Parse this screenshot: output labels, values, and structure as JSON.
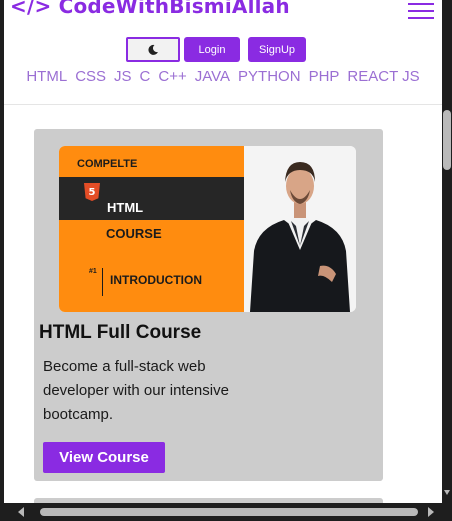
{
  "header": {
    "brand": "</> CodeWithBismiAllah",
    "theme_toggle_icon": "moon-icon",
    "login_label": "Login",
    "signup_label": "SignUp",
    "menu_icon": "hamburger-menu-icon"
  },
  "nav": {
    "items": [
      "HTML",
      "CSS",
      "JS",
      "C",
      "C++",
      "JAVA",
      "PYTHON",
      "PHP",
      "REACT JS"
    ]
  },
  "course": {
    "thumbnail": {
      "line1": "COMPELTE",
      "badge": "5",
      "line2": "HTML",
      "line3": "COURSE",
      "episode": "#1",
      "line4": "INTRODUCTION"
    },
    "title": "HTML Full Course",
    "description": "Become a full-stack web developer with our intensive bootcamp.",
    "button_label": "View Course"
  },
  "colors": {
    "accent": "#8a2be2",
    "nav_text": "#9b6fd3",
    "card_bg": "#cccccc",
    "thumbnail_orange": "#ff8c0f"
  }
}
